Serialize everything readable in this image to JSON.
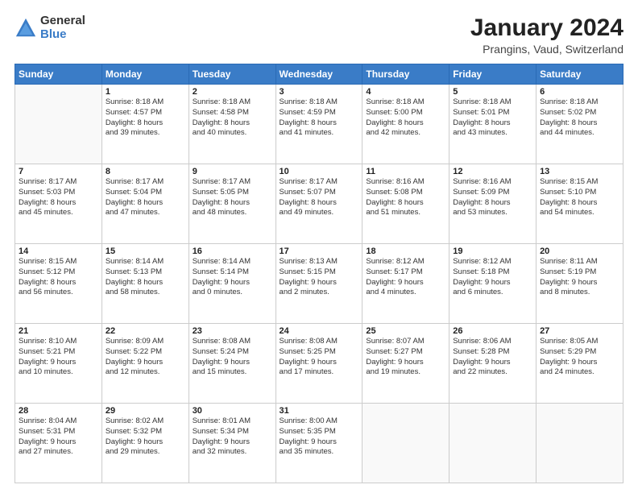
{
  "header": {
    "logo_general": "General",
    "logo_blue": "Blue",
    "main_title": "January 2024",
    "subtitle": "Prangins, Vaud, Switzerland"
  },
  "days_of_week": [
    "Sunday",
    "Monday",
    "Tuesday",
    "Wednesday",
    "Thursday",
    "Friday",
    "Saturday"
  ],
  "weeks": [
    [
      {
        "day": "",
        "sunrise": "",
        "sunset": "",
        "daylight": "",
        "empty": true
      },
      {
        "day": "1",
        "sunrise": "Sunrise: 8:18 AM",
        "sunset": "Sunset: 4:57 PM",
        "daylight1": "Daylight: 8 hours",
        "daylight2": "and 39 minutes."
      },
      {
        "day": "2",
        "sunrise": "Sunrise: 8:18 AM",
        "sunset": "Sunset: 4:58 PM",
        "daylight1": "Daylight: 8 hours",
        "daylight2": "and 40 minutes."
      },
      {
        "day": "3",
        "sunrise": "Sunrise: 8:18 AM",
        "sunset": "Sunset: 4:59 PM",
        "daylight1": "Daylight: 8 hours",
        "daylight2": "and 41 minutes."
      },
      {
        "day": "4",
        "sunrise": "Sunrise: 8:18 AM",
        "sunset": "Sunset: 5:00 PM",
        "daylight1": "Daylight: 8 hours",
        "daylight2": "and 42 minutes."
      },
      {
        "day": "5",
        "sunrise": "Sunrise: 8:18 AM",
        "sunset": "Sunset: 5:01 PM",
        "daylight1": "Daylight: 8 hours",
        "daylight2": "and 43 minutes."
      },
      {
        "day": "6",
        "sunrise": "Sunrise: 8:18 AM",
        "sunset": "Sunset: 5:02 PM",
        "daylight1": "Daylight: 8 hours",
        "daylight2": "and 44 minutes."
      }
    ],
    [
      {
        "day": "7",
        "sunrise": "Sunrise: 8:17 AM",
        "sunset": "Sunset: 5:03 PM",
        "daylight1": "Daylight: 8 hours",
        "daylight2": "and 45 minutes."
      },
      {
        "day": "8",
        "sunrise": "Sunrise: 8:17 AM",
        "sunset": "Sunset: 5:04 PM",
        "daylight1": "Daylight: 8 hours",
        "daylight2": "and 47 minutes."
      },
      {
        "day": "9",
        "sunrise": "Sunrise: 8:17 AM",
        "sunset": "Sunset: 5:05 PM",
        "daylight1": "Daylight: 8 hours",
        "daylight2": "and 48 minutes."
      },
      {
        "day": "10",
        "sunrise": "Sunrise: 8:17 AM",
        "sunset": "Sunset: 5:07 PM",
        "daylight1": "Daylight: 8 hours",
        "daylight2": "and 49 minutes."
      },
      {
        "day": "11",
        "sunrise": "Sunrise: 8:16 AM",
        "sunset": "Sunset: 5:08 PM",
        "daylight1": "Daylight: 8 hours",
        "daylight2": "and 51 minutes."
      },
      {
        "day": "12",
        "sunrise": "Sunrise: 8:16 AM",
        "sunset": "Sunset: 5:09 PM",
        "daylight1": "Daylight: 8 hours",
        "daylight2": "and 53 minutes."
      },
      {
        "day": "13",
        "sunrise": "Sunrise: 8:15 AM",
        "sunset": "Sunset: 5:10 PM",
        "daylight1": "Daylight: 8 hours",
        "daylight2": "and 54 minutes."
      }
    ],
    [
      {
        "day": "14",
        "sunrise": "Sunrise: 8:15 AM",
        "sunset": "Sunset: 5:12 PM",
        "daylight1": "Daylight: 8 hours",
        "daylight2": "and 56 minutes."
      },
      {
        "day": "15",
        "sunrise": "Sunrise: 8:14 AM",
        "sunset": "Sunset: 5:13 PM",
        "daylight1": "Daylight: 8 hours",
        "daylight2": "and 58 minutes."
      },
      {
        "day": "16",
        "sunrise": "Sunrise: 8:14 AM",
        "sunset": "Sunset: 5:14 PM",
        "daylight1": "Daylight: 9 hours",
        "daylight2": "and 0 minutes."
      },
      {
        "day": "17",
        "sunrise": "Sunrise: 8:13 AM",
        "sunset": "Sunset: 5:15 PM",
        "daylight1": "Daylight: 9 hours",
        "daylight2": "and 2 minutes."
      },
      {
        "day": "18",
        "sunrise": "Sunrise: 8:12 AM",
        "sunset": "Sunset: 5:17 PM",
        "daylight1": "Daylight: 9 hours",
        "daylight2": "and 4 minutes."
      },
      {
        "day": "19",
        "sunrise": "Sunrise: 8:12 AM",
        "sunset": "Sunset: 5:18 PM",
        "daylight1": "Daylight: 9 hours",
        "daylight2": "and 6 minutes."
      },
      {
        "day": "20",
        "sunrise": "Sunrise: 8:11 AM",
        "sunset": "Sunset: 5:19 PM",
        "daylight1": "Daylight: 9 hours",
        "daylight2": "and 8 minutes."
      }
    ],
    [
      {
        "day": "21",
        "sunrise": "Sunrise: 8:10 AM",
        "sunset": "Sunset: 5:21 PM",
        "daylight1": "Daylight: 9 hours",
        "daylight2": "and 10 minutes."
      },
      {
        "day": "22",
        "sunrise": "Sunrise: 8:09 AM",
        "sunset": "Sunset: 5:22 PM",
        "daylight1": "Daylight: 9 hours",
        "daylight2": "and 12 minutes."
      },
      {
        "day": "23",
        "sunrise": "Sunrise: 8:08 AM",
        "sunset": "Sunset: 5:24 PM",
        "daylight1": "Daylight: 9 hours",
        "daylight2": "and 15 minutes."
      },
      {
        "day": "24",
        "sunrise": "Sunrise: 8:08 AM",
        "sunset": "Sunset: 5:25 PM",
        "daylight1": "Daylight: 9 hours",
        "daylight2": "and 17 minutes."
      },
      {
        "day": "25",
        "sunrise": "Sunrise: 8:07 AM",
        "sunset": "Sunset: 5:27 PM",
        "daylight1": "Daylight: 9 hours",
        "daylight2": "and 19 minutes."
      },
      {
        "day": "26",
        "sunrise": "Sunrise: 8:06 AM",
        "sunset": "Sunset: 5:28 PM",
        "daylight1": "Daylight: 9 hours",
        "daylight2": "and 22 minutes."
      },
      {
        "day": "27",
        "sunrise": "Sunrise: 8:05 AM",
        "sunset": "Sunset: 5:29 PM",
        "daylight1": "Daylight: 9 hours",
        "daylight2": "and 24 minutes."
      }
    ],
    [
      {
        "day": "28",
        "sunrise": "Sunrise: 8:04 AM",
        "sunset": "Sunset: 5:31 PM",
        "daylight1": "Daylight: 9 hours",
        "daylight2": "and 27 minutes."
      },
      {
        "day": "29",
        "sunrise": "Sunrise: 8:02 AM",
        "sunset": "Sunset: 5:32 PM",
        "daylight1": "Daylight: 9 hours",
        "daylight2": "and 29 minutes."
      },
      {
        "day": "30",
        "sunrise": "Sunrise: 8:01 AM",
        "sunset": "Sunset: 5:34 PM",
        "daylight1": "Daylight: 9 hours",
        "daylight2": "and 32 minutes."
      },
      {
        "day": "31",
        "sunrise": "Sunrise: 8:00 AM",
        "sunset": "Sunset: 5:35 PM",
        "daylight1": "Daylight: 9 hours",
        "daylight2": "and 35 minutes."
      },
      {
        "day": "",
        "empty": true
      },
      {
        "day": "",
        "empty": true
      },
      {
        "day": "",
        "empty": true
      }
    ]
  ]
}
